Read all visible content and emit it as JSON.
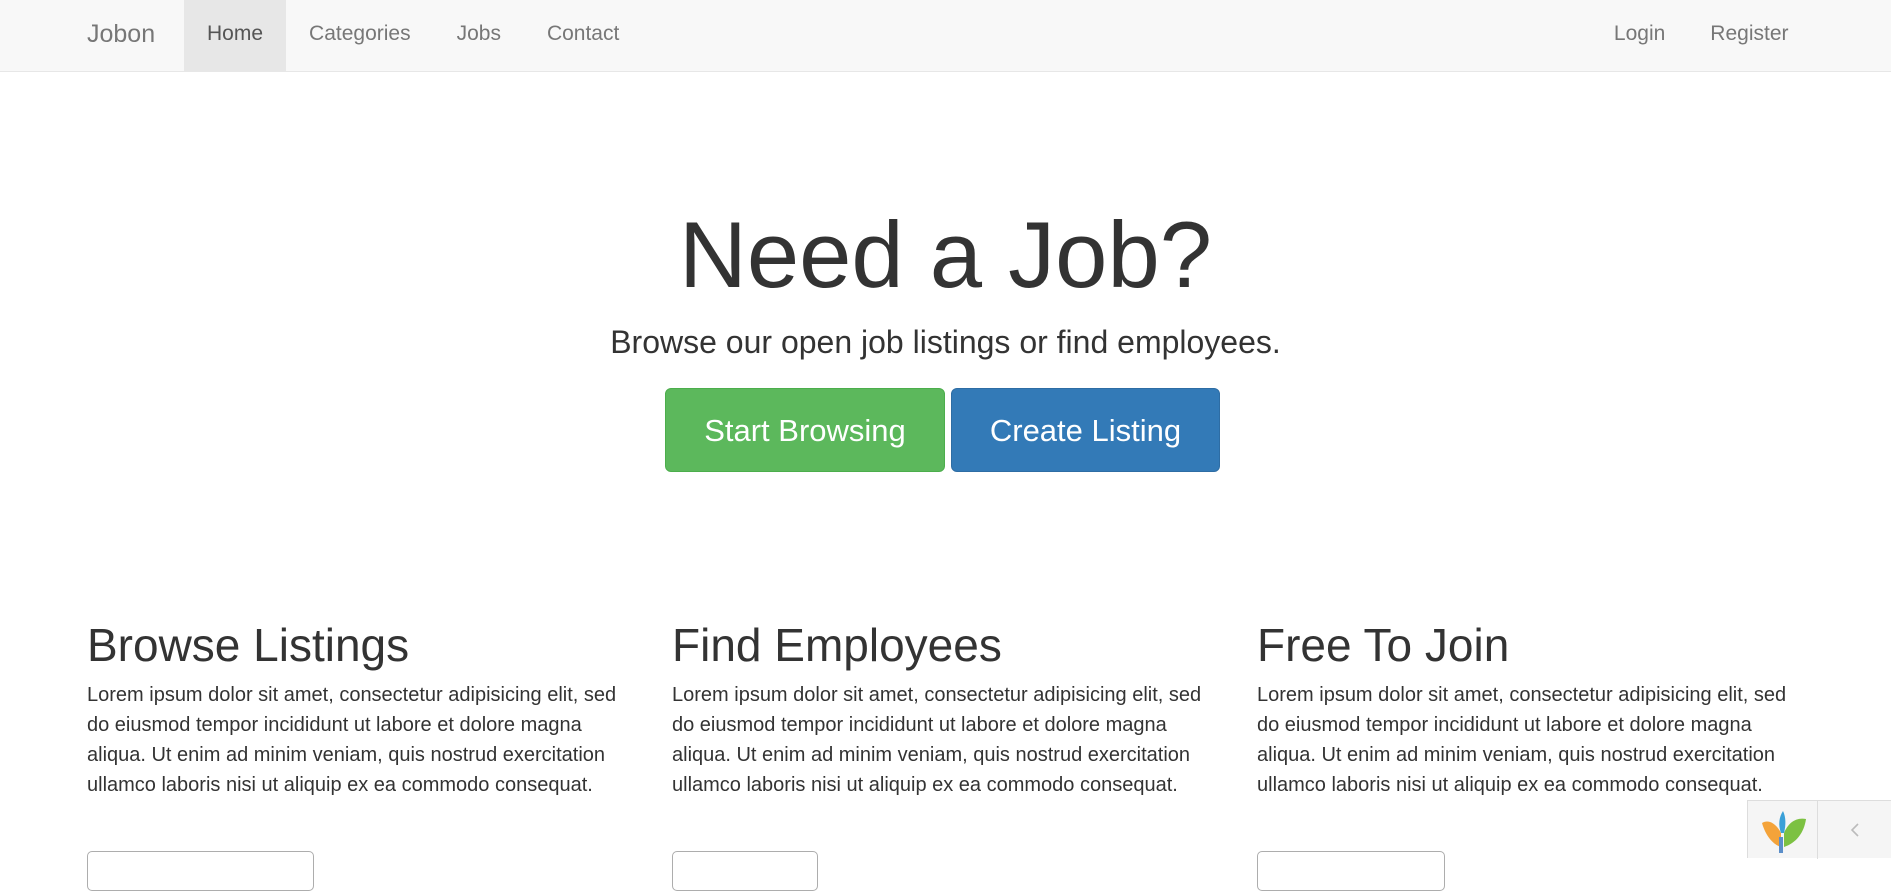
{
  "navbar": {
    "brand": "Jobon",
    "left_items": [
      {
        "label": "Home",
        "active": true
      },
      {
        "label": "Categories",
        "active": false
      },
      {
        "label": "Jobs",
        "active": false
      },
      {
        "label": "Contact",
        "active": false
      }
    ],
    "right_items": [
      {
        "label": "Login"
      },
      {
        "label": "Register"
      }
    ]
  },
  "hero": {
    "title": "Need a Job?",
    "subtitle": "Browse our open job listings or find employees.",
    "primary_button": "Start Browsing",
    "secondary_button": "Create Listing"
  },
  "features": [
    {
      "title": "Browse Listings",
      "text": "Lorem ipsum dolor sit amet, consectetur adipisicing elit, sed do eiusmod tempor incididunt ut labore et dolore magna aliqua. Ut enim ad minim veniam, quis nostrud exercitation ullamco laboris nisi ut aliquip ex ea commodo consequat."
    },
    {
      "title": "Find Employees",
      "text": "Lorem ipsum dolor sit amet, consectetur adipisicing elit, sed do eiusmod tempor incididunt ut labore et dolore magna aliqua. Ut enim ad minim veniam, quis nostrud exercitation ullamco laboris nisi ut aliquip ex ea commodo consequat."
    },
    {
      "title": "Free To Join",
      "text": "Lorem ipsum dolor sit amet, consectetur adipisicing elit, sed do eiusmod tempor incididunt ut labore et dolore magna aliqua. Ut enim ad minim veniam, quis nostrud exercitation ullamco laboris nisi ut aliquip ex ea commodo consequat."
    }
  ],
  "debug_toolbar": {
    "logo_icon": "yii-logo-icon",
    "toggle_icon": "chevron-left-icon"
  },
  "colors": {
    "success": "#5cb85c",
    "primary": "#337ab7",
    "navbar_bg": "#f8f8f8",
    "text": "#333333"
  }
}
